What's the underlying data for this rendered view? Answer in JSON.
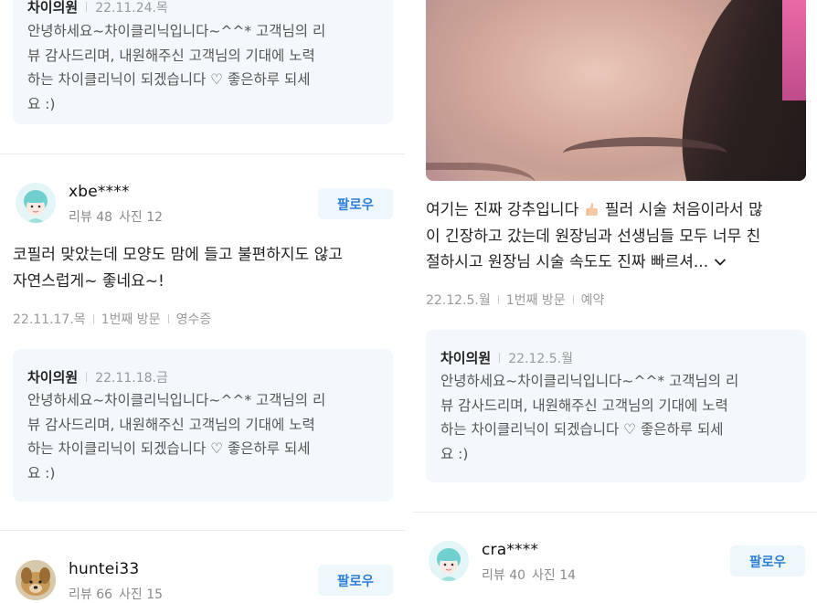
{
  "left": {
    "reply1": {
      "author": "차이의원",
      "date": "22.11.24.목",
      "lines": [
        "안녕하세요~차이클리닉입니다~^^* 고객님의 리",
        "뷰 감사드리며, 내원해주신 고객님의 기대에 노력",
        "하는 차이클리닉이 되겠습니다 ♡ 좋은하루 되세",
        "요 :)"
      ]
    },
    "review1": {
      "username": "xbe****",
      "reviews": "리뷰 48",
      "photos": "사진 12",
      "follow_label": "팔로우",
      "lines": [
        "코필러 맞았는데 모양도 맘에 들고 불편하지도 않고",
        "자연스럽게~ 좋네요~!"
      ],
      "date": "22.11.17.목",
      "visit": "1번째 방문",
      "receipt": "영수증"
    },
    "reply2": {
      "author": "차이의원",
      "date": "22.11.18.금",
      "lines": [
        "안녕하세요~차이클리닉입니다~^^* 고객님의 리",
        "뷰 감사드리며, 내원해주신 고객님의 기대에 노력",
        "하는 차이클리닉이 되겠습니다 ♡ 좋은하루 되세",
        "요 :)"
      ]
    },
    "review2": {
      "username": "huntei33",
      "reviews": "리뷰 66",
      "photos": "사진 15",
      "follow_label": "팔로우"
    }
  },
  "right": {
    "review1": {
      "line1_a": "여기는 진짜 강추입니다 ",
      "line1_b": " 필러 시술 처음이라서 많",
      "line2": "이 긴장하고 갔는데 원장님과 선생님들 모두 너무 친",
      "line3": "절하시고 원장님 시술 속도도 진짜 빠르셔...",
      "date": "22.12.5.월",
      "visit": "1번째 방문",
      "reservation": "예약"
    },
    "reply1": {
      "author": "차이의원",
      "date": "22.12.5.월",
      "lines": [
        "안녕하세요~차이클리닉입니다~^^* 고객님의 리",
        "뷰 감사드리며, 내원해주신 고객님의 기대에 노력",
        "하는 차이클리닉이 되겠습니다 ♡ 좋은하루 되세",
        "요 :)"
      ]
    },
    "review2": {
      "username": "cra****",
      "reviews": "리뷰 40",
      "photos": "사진 14",
      "follow_label": "팔로우"
    }
  },
  "colors": {
    "follow_text": "#2d7ed8",
    "follow_bg": "#eef7fb",
    "reply_bg": "#f2f8fb"
  }
}
